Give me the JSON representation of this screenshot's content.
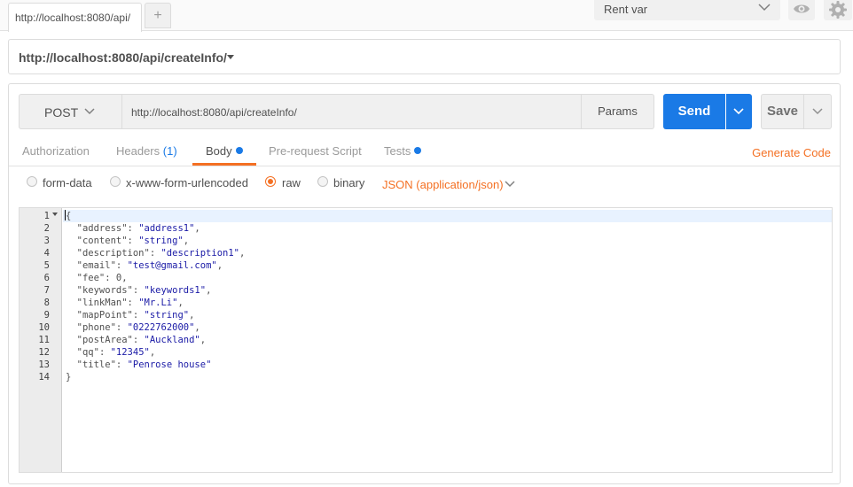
{
  "tabs": {
    "active_tab_label": "http://localhost:8080/api/",
    "new_tab_label": "+"
  },
  "environment": {
    "selected": "Rent var"
  },
  "request_name": "http://localhost:8080/api/createInfo/",
  "request": {
    "method": "POST",
    "url": "http://localhost:8080/api/createInfo/",
    "params_label": "Params",
    "send_label": "Send",
    "save_label": "Save"
  },
  "subtabs": {
    "authorization": "Authorization",
    "headers": "Headers",
    "headers_count": "(1)",
    "body": "Body",
    "prerequest": "Pre-request Script",
    "tests": "Tests",
    "generate_code": "Generate Code"
  },
  "body_modes": {
    "form_data": "form-data",
    "urlencoded": "x-www-form-urlencoded",
    "raw": "raw",
    "binary": "binary",
    "selected": "raw",
    "content_type": "JSON (application/json)"
  },
  "editor": {
    "line_numbers": [
      "1",
      "2",
      "3",
      "4",
      "5",
      "6",
      "7",
      "8",
      "9",
      "10",
      "11",
      "12",
      "13",
      "14"
    ],
    "lines": [
      [
        {
          "t": "{",
          "c": "key"
        }
      ],
      [
        {
          "t": "  \"address\"",
          "c": "key"
        },
        {
          "t": ": ",
          "c": "key"
        },
        {
          "t": "\"address1\"",
          "c": "str"
        },
        {
          "t": ",",
          "c": "key"
        }
      ],
      [
        {
          "t": "  \"content\"",
          "c": "key"
        },
        {
          "t": ": ",
          "c": "key"
        },
        {
          "t": "\"string\"",
          "c": "str"
        },
        {
          "t": ",",
          "c": "key"
        }
      ],
      [
        {
          "t": "  \"description\"",
          "c": "key"
        },
        {
          "t": ": ",
          "c": "key"
        },
        {
          "t": "\"description1\"",
          "c": "str"
        },
        {
          "t": ",",
          "c": "key"
        }
      ],
      [
        {
          "t": "  \"email\"",
          "c": "key"
        },
        {
          "t": ": ",
          "c": "key"
        },
        {
          "t": "\"test@gmail.com\"",
          "c": "str"
        },
        {
          "t": ",",
          "c": "key"
        }
      ],
      [
        {
          "t": "  \"fee\"",
          "c": "key"
        },
        {
          "t": ": ",
          "c": "key"
        },
        {
          "t": "0",
          "c": "num"
        },
        {
          "t": ",",
          "c": "key"
        }
      ],
      [
        {
          "t": "  \"keywords\"",
          "c": "key"
        },
        {
          "t": ": ",
          "c": "key"
        },
        {
          "t": "\"keywords1\"",
          "c": "str"
        },
        {
          "t": ",",
          "c": "key"
        }
      ],
      [
        {
          "t": "  \"linkMan\"",
          "c": "key"
        },
        {
          "t": ": ",
          "c": "key"
        },
        {
          "t": "\"Mr.Li\"",
          "c": "str"
        },
        {
          "t": ",",
          "c": "key"
        }
      ],
      [
        {
          "t": "  \"mapPoint\"",
          "c": "key"
        },
        {
          "t": ": ",
          "c": "key"
        },
        {
          "t": "\"string\"",
          "c": "str"
        },
        {
          "t": ",",
          "c": "key"
        }
      ],
      [
        {
          "t": "  \"phone\"",
          "c": "key"
        },
        {
          "t": ": ",
          "c": "key"
        },
        {
          "t": "\"0222762000\"",
          "c": "str"
        },
        {
          "t": ",",
          "c": "key"
        }
      ],
      [
        {
          "t": "  \"postArea\"",
          "c": "key"
        },
        {
          "t": ": ",
          "c": "key"
        },
        {
          "t": "\"Auckland\"",
          "c": "str"
        },
        {
          "t": ",",
          "c": "key"
        }
      ],
      [
        {
          "t": "  \"qq\"",
          "c": "key"
        },
        {
          "t": ": ",
          "c": "key"
        },
        {
          "t": "\"12345\"",
          "c": "str"
        },
        {
          "t": ",",
          "c": "key"
        }
      ],
      [
        {
          "t": "  \"title\"",
          "c": "key"
        },
        {
          "t": ": ",
          "c": "key"
        },
        {
          "t": "\"Penrose house\"",
          "c": "str"
        }
      ],
      [
        {
          "t": "}",
          "c": "key"
        }
      ]
    ]
  },
  "colors": {
    "accent_orange": "#f47023",
    "send_blue": "#1a7ae6",
    "string_blue": "#1a1aa6"
  },
  "icons": {
    "eye": "eye-icon",
    "gear": "gear-icon",
    "chevron": "chevron-down-icon",
    "caret": "caret-down-icon"
  }
}
